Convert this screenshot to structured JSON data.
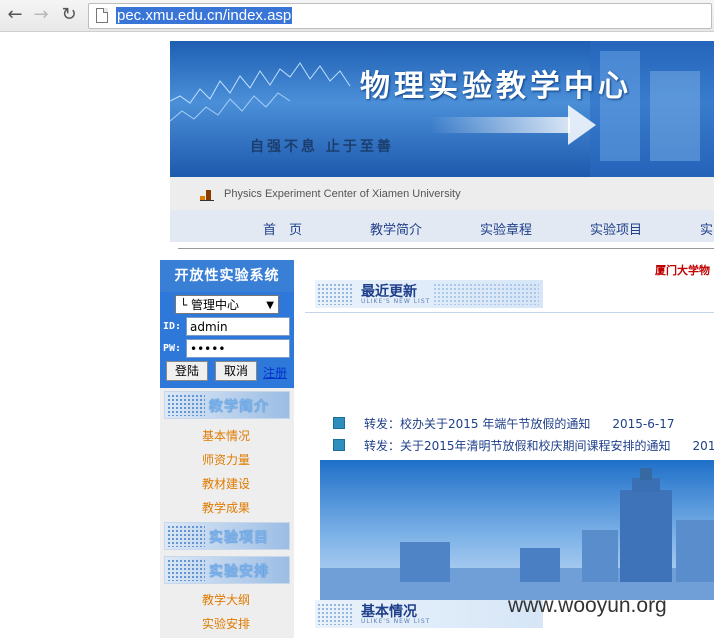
{
  "browser": {
    "back_icon": "back-arrow-icon",
    "forward_icon": "forward-arrow-icon",
    "reload_icon": "reload-icon",
    "url": "pec.xmu.edu.cn/index.asp"
  },
  "banner": {
    "title": "物理实验教学中心",
    "motto": "自强不息 止于至善",
    "subtitle": "Physics  Experiment Center of  Xiamen University"
  },
  "nav": {
    "items": [
      "首　页",
      "教学简介",
      "实验章程",
      "实验项目",
      "实"
    ]
  },
  "sidebar": {
    "system_title": "开放性实验系统",
    "login": {
      "role_selected": "└ 管理中心",
      "id_label": "ID:",
      "id_value": "admin",
      "pw_label": "PW:",
      "pw_value": "•••••",
      "login_button": "登陆",
      "cancel_button": "取消",
      "register_link": "注册"
    },
    "sections": [
      {
        "title": "教学简介",
        "links": [
          "基本情况",
          "师资力量",
          "教材建设",
          "教学成果"
        ]
      },
      {
        "title": "实验项目",
        "links": []
      },
      {
        "title": "实验安排",
        "links": [
          "教学大纲",
          "实验安排"
        ]
      }
    ]
  },
  "content": {
    "top_link": "厦门大学物",
    "latest": {
      "title": "最近更新",
      "subtitle": "ULIKE'S NEW LIST",
      "items": [
        {
          "text": "转发：校办关于2015 年端午节放假的通知",
          "date": "2015-6-17"
        },
        {
          "text": "转发：关于2015年清明节放假和校庆期间课程安排的通知",
          "date": "201"
        }
      ]
    },
    "basic": {
      "title": "基本情况",
      "subtitle": "ULIKE'S NEW LIST"
    }
  },
  "watermark": "www.wooyun.org"
}
